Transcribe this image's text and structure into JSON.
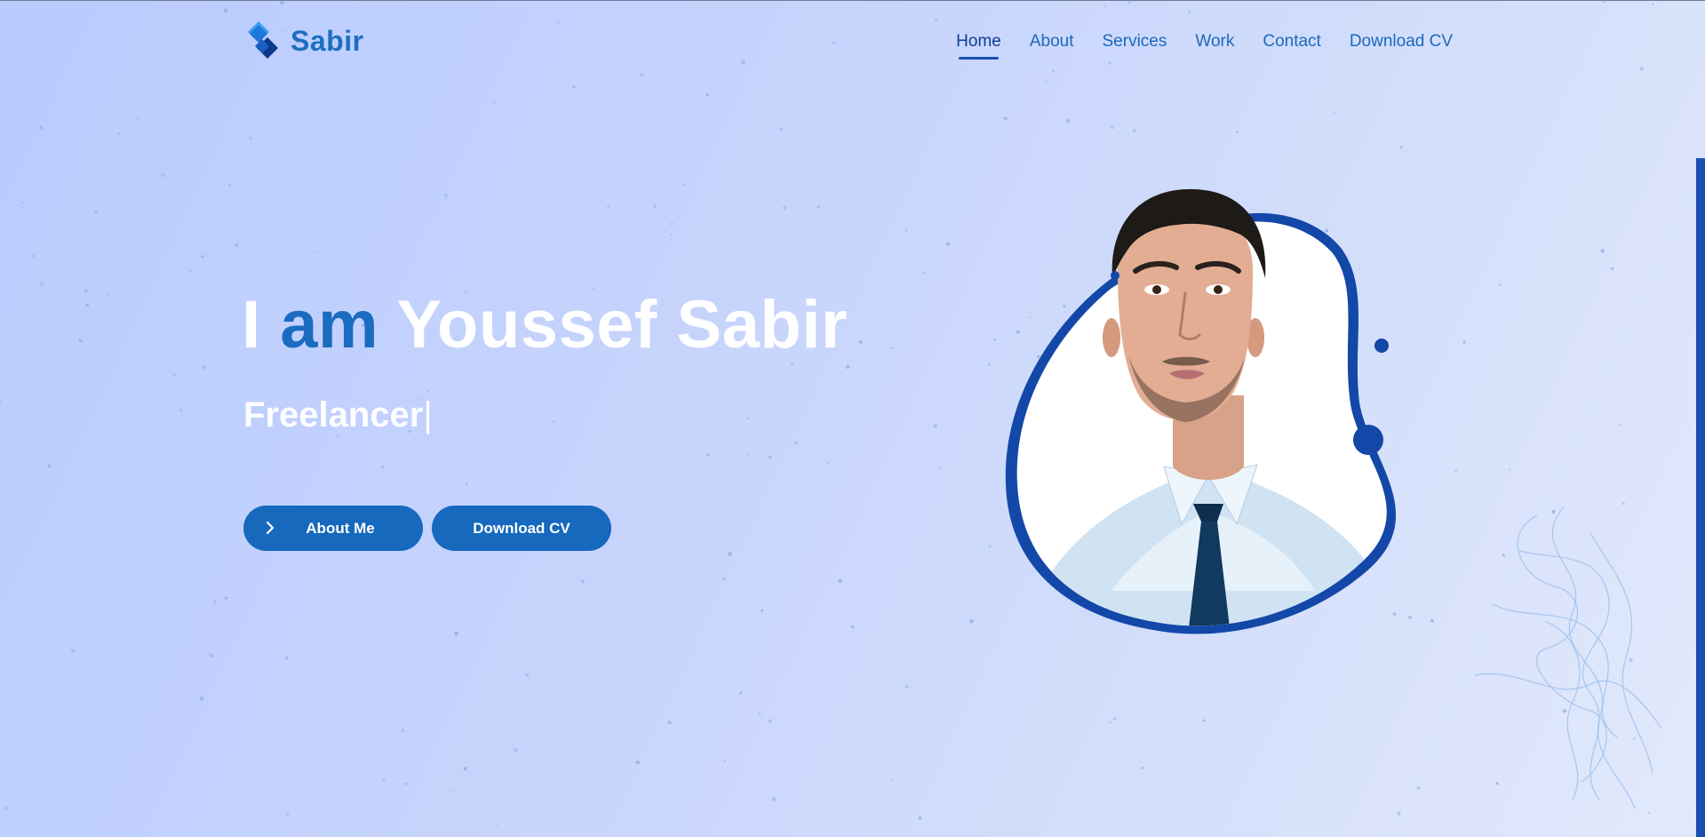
{
  "brand": {
    "name": "Sabir",
    "logo_icon": "diamond-logo-icon"
  },
  "nav": {
    "items": [
      {
        "label": "Home",
        "active": true
      },
      {
        "label": "About",
        "active": false
      },
      {
        "label": "Services",
        "active": false
      },
      {
        "label": "Work",
        "active": false
      },
      {
        "label": "Contact",
        "active": false
      },
      {
        "label": "Download CV",
        "active": false
      }
    ]
  },
  "hero": {
    "intro_i": "I",
    "intro_am": "am",
    "name": "Youssef Sabir",
    "role": "Freelancer",
    "cursor": "|",
    "about_button": "About Me",
    "about_button_icon": "chevron-right-icon",
    "download_button": "Download CV"
  },
  "colors": {
    "accent": "#1a6cc0",
    "button": "#1669bd",
    "blob": "#1348a8",
    "nav_active": "#0d3f8f"
  }
}
